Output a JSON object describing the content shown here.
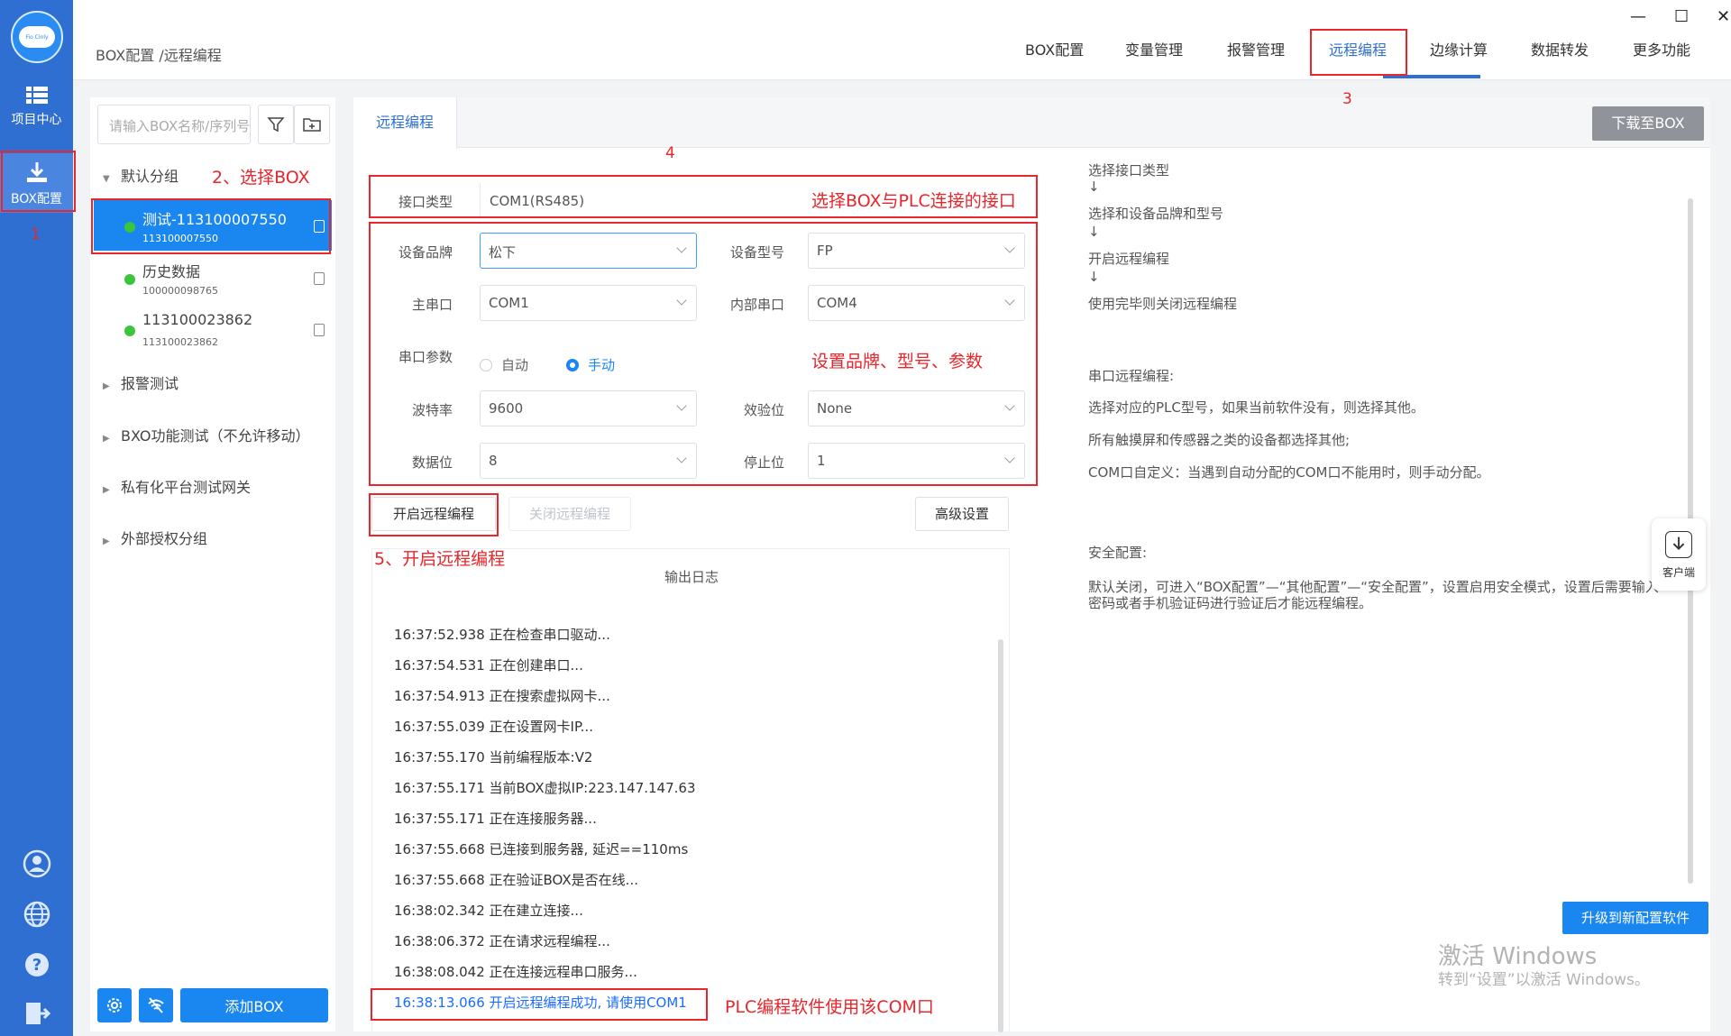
{
  "app": {
    "logo_text": "Fio Cinly",
    "breadcrumb": "BOX配置 /远程编程",
    "window_controls": [
      "—",
      "☐",
      "✕"
    ]
  },
  "rail": {
    "items": [
      {
        "label": "项目中心",
        "icon": "grid-icon"
      },
      {
        "label": "BOX配置",
        "icon": "download-icon"
      }
    ],
    "bottom_icons": [
      "user-icon",
      "globe-icon",
      "help-icon",
      "logout-icon"
    ]
  },
  "nav": {
    "tabs": [
      "BOX配置",
      "变量管理",
      "报警管理",
      "远程编程",
      "边缘计算",
      "数据转发",
      "更多功能"
    ],
    "active": "远程编程"
  },
  "sidebar": {
    "search_placeholder": "请输入BOX名称/序列号",
    "groups": [
      {
        "label": "默认分组",
        "expanded": true
      },
      {
        "label": "报警测试",
        "expanded": false
      },
      {
        "label": "BXO功能测试（不允许移动）",
        "expanded": false
      },
      {
        "label": "私有化平台测试网关",
        "expanded": false
      },
      {
        "label": "外部授权分组",
        "expanded": false
      }
    ],
    "boxes": [
      {
        "name": "测试-113100007550",
        "sn": "113100007550",
        "selected": true
      },
      {
        "name": "历史数据",
        "sn": "100000098765",
        "selected": false
      },
      {
        "name": "113100023862",
        "sn": "113100023862",
        "selected": false
      }
    ],
    "add_box_label": "添加BOX"
  },
  "main": {
    "tab_label": "远程编程",
    "download_label": "下载至BOX",
    "form": {
      "interface_label": "接口类型",
      "interface_value": "COM1(RS485)",
      "brand_label": "设备品牌",
      "brand_value": "松下",
      "model_label": "设备型号",
      "model_value": "FP",
      "main_port_label": "主串口",
      "main_port_value": "COM1",
      "inner_port_label": "内部串口",
      "inner_port_value": "COM4",
      "serial_param_label": "串口参数",
      "radio_auto": "自动",
      "radio_manual": "手动",
      "baud_label": "波特率",
      "baud_value": "9600",
      "parity_label": "效验位",
      "parity_value": "None",
      "databits_label": "数据位",
      "databits_value": "8",
      "stopbits_label": "停止位",
      "stopbits_value": "1"
    },
    "buttons": {
      "start": "开启远程编程",
      "stop": "关闭远程编程",
      "advanced": "高级设置"
    },
    "log": {
      "title": "输出日志",
      "lines": [
        "16:37:52.938 正在检查串口驱动...",
        "16:37:54.531 正在创建串口...",
        "16:37:54.913 正在搜索虚拟网卡...",
        "16:37:55.039 正在设置网卡IP...",
        "16:37:55.170 当前编程版本:V2",
        "16:37:55.171 当前BOX虚拟IP:223.147.147.63",
        "16:37:55.171 正在连接服务器...",
        "16:37:55.668 已连接到服务器, 延迟==110ms",
        "16:37:55.668 正在验证BOX是否在线...",
        "16:38:02.342 正在建立连接...",
        "16:38:06.372 正在请求远程编程...",
        "16:38:08.042 正在连接远程串口服务...",
        "16:38:13.066 开启远程编程成功, 请使用COM1"
      ]
    },
    "help": {
      "steps": [
        "选择接口类型",
        "↓",
        "选择和设备品牌和型号",
        "↓",
        "开启远程编程",
        "↓",
        "使用完毕则关闭远程编程"
      ],
      "serial_title": "串口远程编程:",
      "serial_lines": [
        "选择对应的PLC型号，如果当前软件没有，则选择其他。",
        "所有触摸屏和传感器之类的设备都选择其他;",
        "COM口自定义：当遇到自动分配的COM口不能用时，则手动分配。"
      ],
      "security_title": "安全配置:",
      "security_lines": [
        "默认关闭，可进入“BOX配置”—“其他配置”—“安全配置”，设置启用安全模式，设置后需要输入",
        "密码或者手机验证码进行验证后才能远程编程。"
      ]
    },
    "upgrade_label": "升级到新配置软件",
    "client_label": "客户端"
  },
  "annotations": {
    "n1": "1",
    "n2": "2、选择BOX",
    "n3": "3",
    "n4": "4",
    "iface_note": "选择BOX与PLC连接的接口",
    "params_note": "设置品牌、型号、参数",
    "n5": "5、开启远程编程",
    "com_note": "PLC编程软件使用该COM口"
  },
  "watermark": {
    "line1": "激活 Windows",
    "line2": "转到“设置”以激活 Windows。"
  },
  "colors": {
    "accent": "#1a86f0",
    "rail": "#2f6fd1",
    "annotation": "#e8262b"
  }
}
